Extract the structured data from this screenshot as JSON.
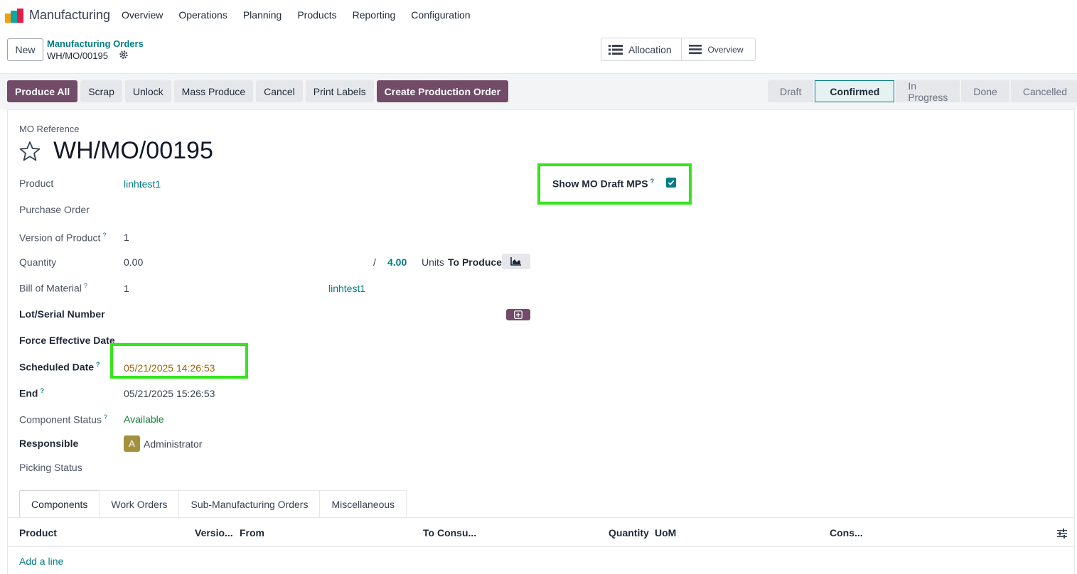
{
  "app": {
    "name": "Manufacturing"
  },
  "nav": {
    "items": [
      "Overview",
      "Operations",
      "Planning",
      "Products",
      "Reporting",
      "Configuration"
    ]
  },
  "control": {
    "new_label": "New",
    "breadcrumb_parent": "Manufacturing Orders",
    "breadcrumb_current": "WH/MO/00195",
    "smart_allocation": "Allocation",
    "smart_overview": "Overview"
  },
  "actions": {
    "produce_all": "Produce All",
    "scrap": "Scrap",
    "unlock": "Unlock",
    "mass_produce": "Mass Produce",
    "cancel": "Cancel",
    "print_labels": "Print Labels",
    "create_production_order": "Create Production Order"
  },
  "stages": {
    "draft": "Draft",
    "confirmed": "Confirmed",
    "in_progress": "In Progress",
    "done": "Done",
    "cancelled": "Cancelled",
    "current": "Confirmed"
  },
  "form": {
    "mo_ref_label": "MO Reference",
    "mo_ref": "WH/MO/00195",
    "product_label": "Product",
    "product": "linhtest1",
    "purchase_order_label": "Purchase Order",
    "version_label": "Version of Product",
    "version": "1",
    "quantity_label": "Quantity",
    "quantity_done": "0.00",
    "quantity_sep": "/",
    "quantity_total": "4.00",
    "units_label": "Units",
    "to_produce_label": "To Produce",
    "bom_label": "Bill of Material",
    "bom_version": "1",
    "bom_product": "linhtest1",
    "lot_label": "Lot/Serial Number",
    "force_date_label": "Force Effective Date",
    "scheduled_label": "Scheduled Date",
    "scheduled": "05/21/2025 14:26:53",
    "end_label": "End",
    "end": "05/21/2025 15:26:53",
    "component_status_label": "Component Status",
    "component_status": "Available",
    "responsible_label": "Responsible",
    "responsible_initial": "A",
    "responsible": "Administrator",
    "picking_status_label": "Picking Status",
    "show_mo_draft_label": "Show MO Draft MPS",
    "show_mo_draft_checked": true,
    "help_mark": "?"
  },
  "tabs": [
    "Components",
    "Work Orders",
    "Sub-Manufacturing Orders",
    "Miscellaneous"
  ],
  "table": {
    "headers": [
      "Product",
      "Versio...",
      "From",
      "To Consu...",
      "Quantity",
      "UoM",
      "Cons..."
    ],
    "add_line": "Add a line"
  },
  "colors": {
    "primary": "#714b67",
    "link": "#017e84",
    "highlight": "#33e61a",
    "warn": "#a16207",
    "available": "#15803d"
  }
}
